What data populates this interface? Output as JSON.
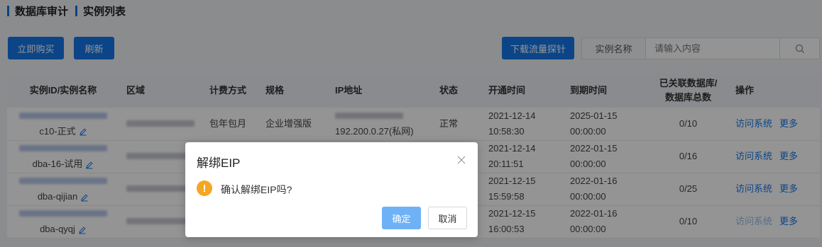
{
  "breadcrumb": {
    "section": "数据库审计",
    "page": "实例列表"
  },
  "toolbar": {
    "buy_label": "立即购买",
    "refresh_label": "刷新",
    "download_label": "下载流量探针"
  },
  "search": {
    "label": "实例名称",
    "placeholder": "请输入内容"
  },
  "table": {
    "headers": [
      "实例ID/实例名称",
      "区域",
      "计费方式",
      "规格",
      "IP地址",
      "状态",
      "开通时间",
      "到期时间",
      "已关联数据库/数据库总数",
      "操作"
    ],
    "rows": [
      {
        "name": "c10-正式",
        "billing": "包年包月",
        "spec": "企业增强版",
        "ip": "192.200.0.27(私网)",
        "status": "正常",
        "open_time": "2021-12-14 10:58:30",
        "expire_time": "2025-01-15 00:00:00",
        "db_count": "0/10",
        "op_visit": "访问系统",
        "op_more": "更多"
      },
      {
        "name": "dba-16-试用",
        "billing": "",
        "spec": "",
        "ip": "",
        "status": "",
        "open_time": "2021-12-14 20:11:51",
        "expire_time": "2022-01-15 00:00:00",
        "db_count": "0/16",
        "op_visit": "访问系统",
        "op_more": "更多"
      },
      {
        "name": "dba-qijian",
        "billing": "",
        "spec": "",
        "ip": "",
        "status": "",
        "open_time": "2021-12-15 15:59:58",
        "expire_time": "2022-01-16 00:00:00",
        "db_count": "0/25",
        "op_visit": "访问系统",
        "op_more": "更多"
      },
      {
        "name": "dba-qyqj",
        "billing": "",
        "spec": "",
        "ip": "",
        "status": "",
        "open_time": "2021-12-15 16:00:53",
        "expire_time": "2022-01-16 00:00:00",
        "db_count": "0/10",
        "op_visit": "访问系统",
        "op_more": "更多"
      }
    ]
  },
  "dialog": {
    "title": "解绑EIP",
    "message": "确认解绑EIP吗?",
    "confirm_label": "确定",
    "cancel_label": "取消"
  },
  "colors": {
    "primary": "#1677e8",
    "warning": "#f5a623",
    "confirm_disabled": "#6fb1f5"
  }
}
